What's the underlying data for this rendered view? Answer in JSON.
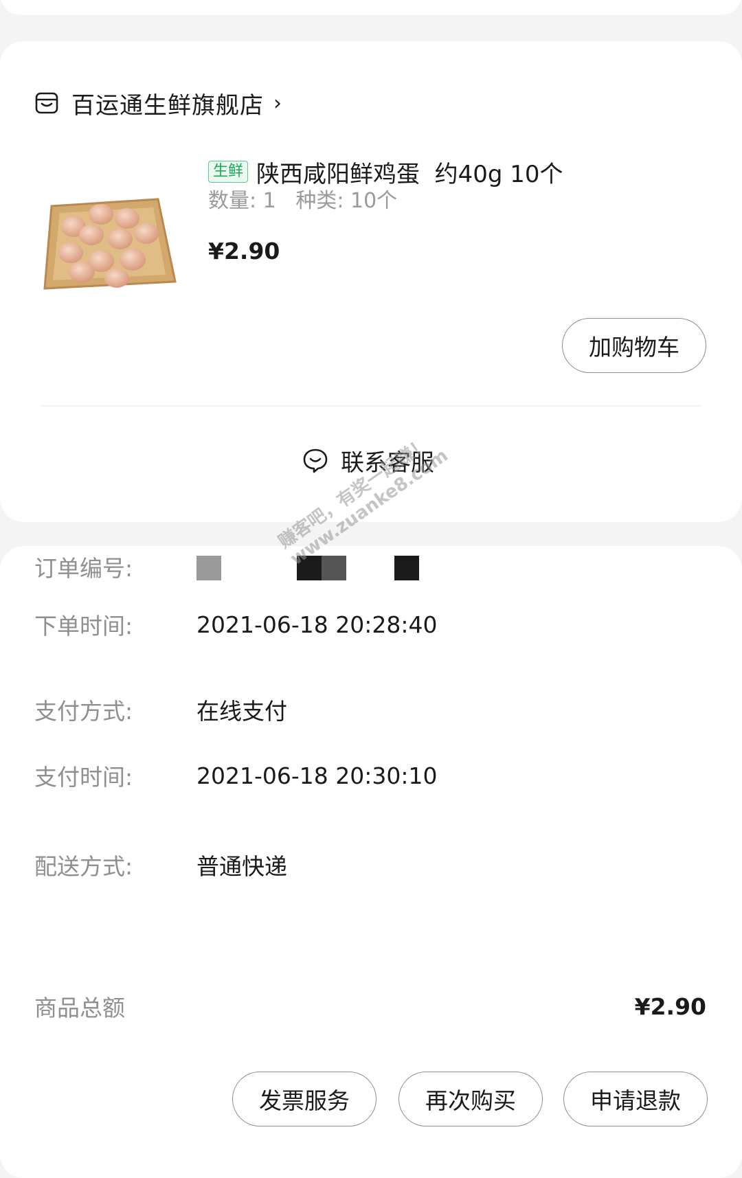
{
  "shop": {
    "name": "百运通生鲜旗舰店",
    "store_icon": "store-icon",
    "chevron": "›"
  },
  "product": {
    "image": "eggs-in-basket",
    "tag": "生鲜",
    "title": "陕西咸阳鲜鸡蛋  约40g 10个",
    "spec": "数量: 1   种类: 10个",
    "price": "¥2.90",
    "add_cart_label": "加购物车"
  },
  "contact": {
    "icon": "chat-bubble-icon",
    "label": "联系客服"
  },
  "order": {
    "rows": [
      {
        "label": "订单编号:",
        "value": ""
      },
      {
        "label": "下单时间:",
        "value": "2021-06-18 20:28:40"
      },
      {
        "label": "支付方式:",
        "value": "在线支付"
      },
      {
        "label": "支付时间:",
        "value": "2021-06-18 20:30:10"
      },
      {
        "label": "配送方式:",
        "value": "普通快递"
      }
    ],
    "total_label": "商品总额",
    "total_value": "¥2.90"
  },
  "actions": {
    "invoice": "发票服务",
    "rebuy": "再次购买",
    "refund": "申请退款"
  },
  "watermark": {
    "line1": "赚客吧，有奖一起赚！",
    "line2": "www.zuanke8.com"
  },
  "colors": {
    "background": "#f4f4f4",
    "card": "#ffffff",
    "fresh_tag": "#1fa85a",
    "muted_text": "#8f8f8f"
  }
}
